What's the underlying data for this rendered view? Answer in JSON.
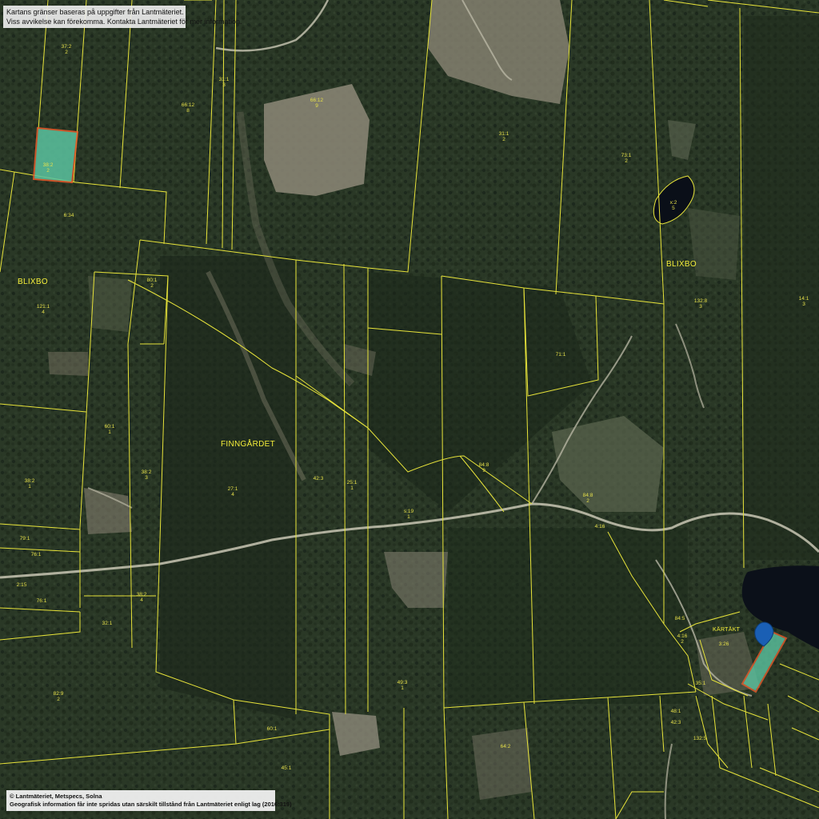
{
  "notice": {
    "line1": "Kartans gränser baseras på uppgifter från Lantmäteriet.",
    "line2": "Viss avvikelse kan förekomma. Kontakta Lantmäteriet för mer information."
  },
  "copyright": {
    "line1": "© Lantmäteriet, Metspecs, Solna",
    "line2": "Geografisk information får inte spridas utan särskilt tillstånd från Lantmäteriet enligt lag (2016:319)"
  },
  "place_names": {
    "blixbo_west": "BLIXBO",
    "blixbo_east": "BLIXBO",
    "finngardet": "FINNGÅRDET",
    "kartakt": "KÄRTÄKT"
  },
  "parcels": [
    {
      "label": "37:2",
      "sub": "2"
    },
    {
      "label": "38:2",
      "sub": "2"
    },
    {
      "label": "6:34",
      "sub": ""
    },
    {
      "label": "31:1",
      "sub": "3"
    },
    {
      "label": "66:12",
      "sub": "8"
    },
    {
      "label": "66:12",
      "sub": "9"
    },
    {
      "label": "31:1",
      "sub": "2"
    },
    {
      "label": "73:1",
      "sub": "2"
    },
    {
      "label": "x:2",
      "sub": "5"
    },
    {
      "label": "121:1",
      "sub": "4"
    },
    {
      "label": "80:1",
      "sub": "2"
    },
    {
      "label": "132:8",
      "sub": "3"
    },
    {
      "label": "14:1",
      "sub": "3"
    },
    {
      "label": "71:1",
      "sub": ""
    },
    {
      "label": "60:1",
      "sub": "1"
    },
    {
      "label": "38:2",
      "sub": "1"
    },
    {
      "label": "38:2",
      "sub": "3"
    },
    {
      "label": "27:1",
      "sub": "4"
    },
    {
      "label": "42:3",
      "sub": ""
    },
    {
      "label": "25:1",
      "sub": "1"
    },
    {
      "label": "84:8",
      "sub": "9"
    },
    {
      "label": "84:8",
      "sub": "2"
    },
    {
      "label": "s:19",
      "sub": "1"
    },
    {
      "label": "4:16",
      "sub": ""
    },
    {
      "label": "79:1",
      "sub": ""
    },
    {
      "label": "76:1",
      "sub": ""
    },
    {
      "label": "2:15",
      "sub": ""
    },
    {
      "label": "76:1",
      "sub": ""
    },
    {
      "label": "38:2",
      "sub": "4"
    },
    {
      "label": "32:1",
      "sub": ""
    },
    {
      "label": "82:9",
      "sub": "2"
    },
    {
      "label": "49:3",
      "sub": "1"
    },
    {
      "label": "60:1",
      "sub": ""
    },
    {
      "label": "45:1",
      "sub": ""
    },
    {
      "label": "48:1",
      "sub": ""
    },
    {
      "label": "64:2",
      "sub": ""
    },
    {
      "label": "84:5",
      "sub": ""
    },
    {
      "label": "4:16",
      "sub": "2"
    },
    {
      "label": "35:1",
      "sub": ""
    },
    {
      "label": "3:26",
      "sub": ""
    },
    {
      "label": "42:3",
      "sub": ""
    },
    {
      "label": "132:5",
      "sub": ""
    }
  ],
  "colors": {
    "boundary": "#e7e33a",
    "selected_fill": "#5bc3a0",
    "selected_outline": "#e85a2a",
    "water": "#0a0f18",
    "forest_dark": "#1d2a1b",
    "forest_mid": "#2c3b28",
    "clearing": "#8e8a7a",
    "road": "#c8c6b6",
    "marker": "#1a5fb4"
  },
  "icons": {
    "location_marker": "map-pin-icon"
  }
}
